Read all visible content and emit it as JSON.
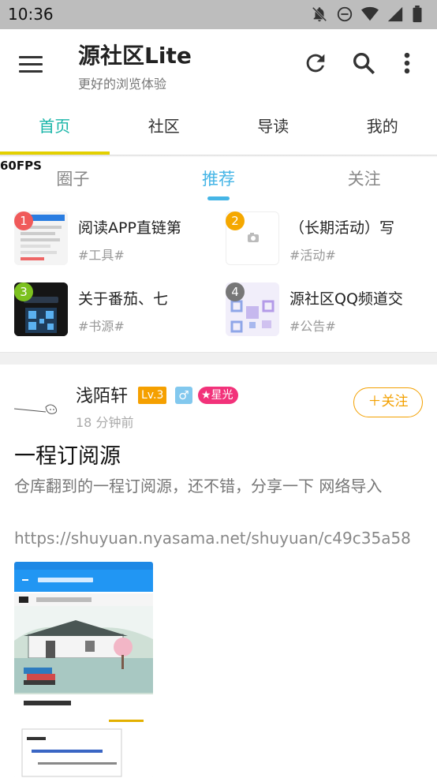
{
  "status_bar": {
    "time": "10:36",
    "icons": [
      "notifications-off-icon",
      "do-not-disturb-icon",
      "wifi-icon",
      "signal-icon",
      "battery-icon"
    ]
  },
  "app_bar": {
    "title": "源社区Lite",
    "subtitle": "更好的浏览体验",
    "actions": [
      "refresh-icon",
      "search-icon",
      "more-vert-icon"
    ]
  },
  "main_tabs": [
    {
      "label": "首页",
      "active": true
    },
    {
      "label": "社区",
      "active": false
    },
    {
      "label": "导读",
      "active": false
    },
    {
      "label": "我的",
      "active": false
    }
  ],
  "fps": "60FPS",
  "sub_tabs": [
    {
      "label": "圈子",
      "active": false
    },
    {
      "label": "推荐",
      "active": true
    },
    {
      "label": "关注",
      "active": false
    }
  ],
  "recommend": [
    {
      "rank": "1",
      "title": "阅读APP直链第",
      "tag": "#工具#",
      "badge_color": "#f05a5a"
    },
    {
      "rank": "2",
      "title": "（长期活动）写",
      "tag": "#活动#",
      "badge_color": "#f5a800"
    },
    {
      "rank": "3",
      "title": "关于番茄、七",
      "tag": "#书源#",
      "badge_color": "#7cc11f"
    },
    {
      "rank": "4",
      "title": "源社区QQ频道交",
      "tag": "#公告#",
      "badge_color": "#777777"
    }
  ],
  "post": {
    "author": "浅陌轩",
    "level": "Lv.3",
    "gender_icon": "male-icon",
    "gender_symbol": "♂",
    "star_badge": "★星光",
    "time_ago": "18 分钟前",
    "follow_label": "＋关注",
    "title": "一程订阅源",
    "body": "仓库翻到的一程订阅源，还不错，分享一下 网络导入",
    "link": "https://shuyuan.nyasama.net/shuyuan/c49c35a58"
  },
  "colors": {
    "accent_tab": "#19b5a8",
    "tab_indicator": "#e3d000",
    "sub_tab_active": "#45b5e6",
    "follow": "#f3a000"
  }
}
